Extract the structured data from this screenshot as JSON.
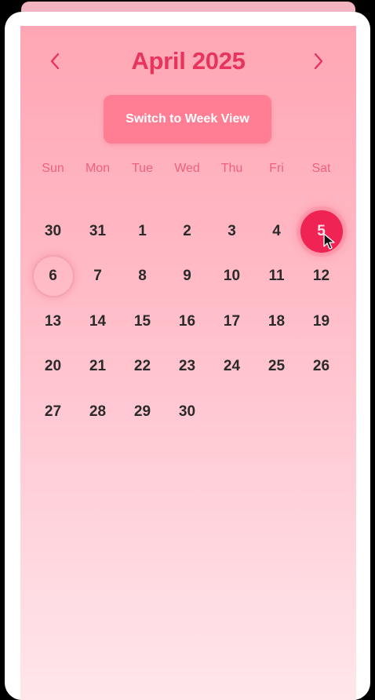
{
  "calendar": {
    "title": "April 2025",
    "switch_label": "Switch to Week View",
    "weekdays": [
      "Sun",
      "Mon",
      "Tue",
      "Wed",
      "Thu",
      "Fri",
      "Sat"
    ],
    "selected_day": "5",
    "today_day": "6",
    "days": [
      {
        "label": "30",
        "state": "normal"
      },
      {
        "label": "31",
        "state": "normal"
      },
      {
        "label": "1",
        "state": "normal"
      },
      {
        "label": "2",
        "state": "normal"
      },
      {
        "label": "3",
        "state": "normal"
      },
      {
        "label": "4",
        "state": "normal"
      },
      {
        "label": "5",
        "state": "selected"
      },
      {
        "label": "6",
        "state": "today"
      },
      {
        "label": "7",
        "state": "normal"
      },
      {
        "label": "8",
        "state": "normal"
      },
      {
        "label": "9",
        "state": "normal"
      },
      {
        "label": "10",
        "state": "normal"
      },
      {
        "label": "11",
        "state": "normal"
      },
      {
        "label": "12",
        "state": "normal"
      },
      {
        "label": "13",
        "state": "normal"
      },
      {
        "label": "14",
        "state": "normal"
      },
      {
        "label": "15",
        "state": "normal"
      },
      {
        "label": "16",
        "state": "normal"
      },
      {
        "label": "17",
        "state": "normal"
      },
      {
        "label": "18",
        "state": "normal"
      },
      {
        "label": "19",
        "state": "normal"
      },
      {
        "label": "20",
        "state": "normal"
      },
      {
        "label": "21",
        "state": "normal"
      },
      {
        "label": "22",
        "state": "normal"
      },
      {
        "label": "23",
        "state": "normal"
      },
      {
        "label": "24",
        "state": "normal"
      },
      {
        "label": "25",
        "state": "normal"
      },
      {
        "label": "26",
        "state": "normal"
      },
      {
        "label": "27",
        "state": "normal"
      },
      {
        "label": "28",
        "state": "normal"
      },
      {
        "label": "29",
        "state": "normal"
      },
      {
        "label": "30",
        "state": "normal"
      }
    ]
  },
  "icons": {
    "prev": "chevron-left-icon",
    "next": "chevron-right-icon",
    "cursor": "mouse-pointer-icon"
  },
  "colors": {
    "accent": "#e8345c",
    "selected": "#ef2454",
    "button": "#ff7e93",
    "weekday": "#f0607e",
    "day_text": "#2a2a2a"
  }
}
